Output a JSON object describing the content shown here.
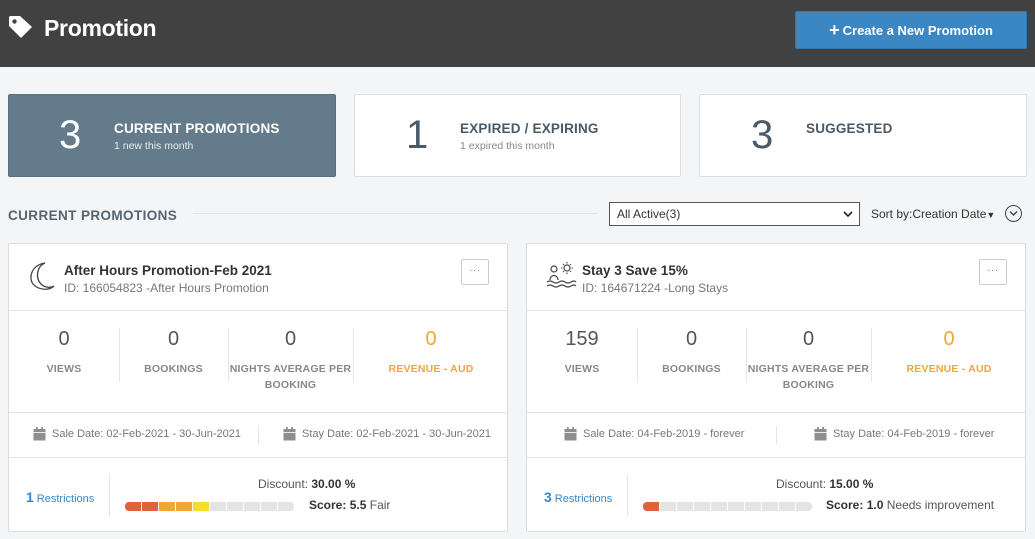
{
  "header": {
    "title": "Promotion",
    "create_label": "Create a New Promotion"
  },
  "summary": [
    {
      "count": "3",
      "label": "CURRENT PROMOTIONS",
      "sub": "1 new this month"
    },
    {
      "count": "1",
      "label": "EXPIRED / EXPIRING",
      "sub": "1 expired this month"
    },
    {
      "count": "3",
      "label": "SUGGESTED",
      "sub": ""
    }
  ],
  "section": {
    "title": "CURRENT PROMOTIONS",
    "filter_value": "All Active(3)",
    "sort_label": "Sort by:Creation Date"
  },
  "colors": {
    "score_red": "#e0613a",
    "score_orange": "#f0a830",
    "score_yellow": "#f5dd2f",
    "score_empty": "#e4e4e4",
    "accent_blue": "#3a87c4",
    "revenue_orange": "#eda63e"
  },
  "cards": [
    {
      "icon": "moon-icon",
      "name": "After Hours Promotion-Feb 2021",
      "id_text": "ID: 166054823 -After Hours Promotion",
      "more_label": "···",
      "stats": {
        "views": "0",
        "views_label": "VIEWS",
        "bookings": "0",
        "bookings_label": "BOOKINGS",
        "nights": "0",
        "nights_label_1": "NIGHTS AVERAGE PER",
        "nights_label_2": "BOOKING",
        "revenue": "0",
        "revenue_label": "REVENUE - AUD"
      },
      "sale_date": "Sale Date: 02-Feb-2021 - 30-Jun-2021",
      "stay_date": "Stay Date: 02-Feb-2021 - 30-Jun-2021",
      "restrictions_count": "1",
      "restrictions_label": "Restrictions",
      "discount_label": "Discount:",
      "discount_value": "30.00 %",
      "score_label": "Score:",
      "score_value": "5.5",
      "score_word": "Fair",
      "score_segments": 10,
      "score_colors": [
        "#e0613a",
        "#e0613a",
        "#f0a830",
        "#f0a830",
        "#f5dd2f"
      ]
    },
    {
      "icon": "beach-sun-icon",
      "name": "Stay 3 Save 15%",
      "id_text": "ID: 164671224 -Long Stays",
      "more_label": "···",
      "stats": {
        "views": "159",
        "views_label": "VIEWS",
        "bookings": "0",
        "bookings_label": "BOOKINGS",
        "nights": "0",
        "nights_label_1": "NIGHTS AVERAGE PER",
        "nights_label_2": "BOOKING",
        "revenue": "0",
        "revenue_label": "REVENUE - AUD"
      },
      "sale_date": "Sale Date: 04-Feb-2019 - forever",
      "stay_date": "Stay Date: 04-Feb-2019 - forever",
      "restrictions_count": "3",
      "restrictions_label": "Restrictions",
      "discount_label": "Discount:",
      "discount_value": "15.00 %",
      "score_label": "Score:",
      "score_value": "1.0",
      "score_word": "Needs improvement",
      "score_segments": 10,
      "score_colors": [
        "#e0613a"
      ]
    }
  ]
}
